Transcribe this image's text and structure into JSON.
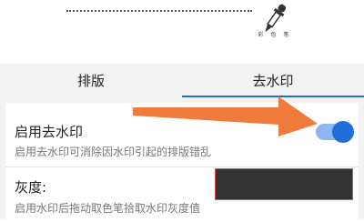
{
  "preview": {
    "watermark_caption": "彩 色 笔"
  },
  "tabs": [
    {
      "label": "排版"
    },
    {
      "label": "去水印"
    }
  ],
  "settings": {
    "remove_watermark": {
      "title": "启用去水印",
      "description": "启用去水印可消除因水印引起的排版错乱",
      "enabled": true
    },
    "grayscale": {
      "title": "灰度:",
      "description": "启用水印后拖动取色笔拾取水印灰度值",
      "color": "#333333"
    }
  },
  "colors": {
    "accent": "#1f6fd9",
    "arrow": "#f07b3c"
  }
}
